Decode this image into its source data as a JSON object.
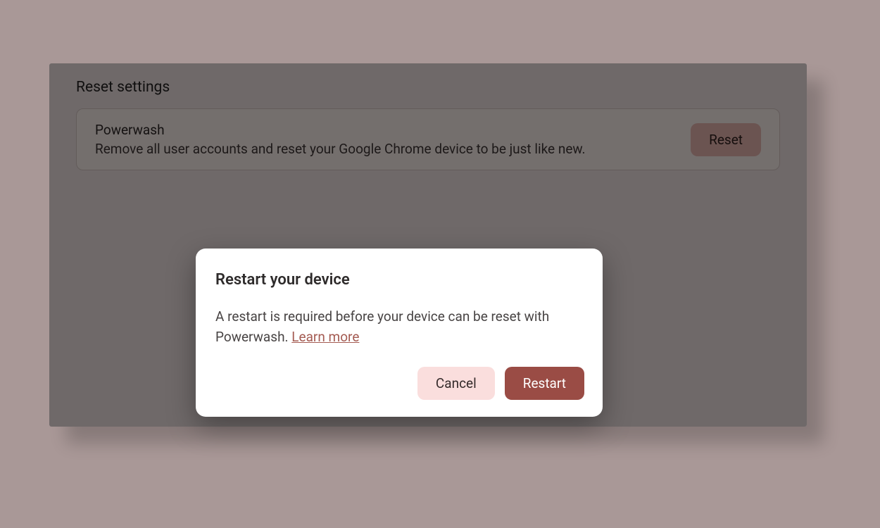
{
  "section": {
    "title": "Reset settings"
  },
  "row": {
    "title": "Powerwash",
    "description": "Remove all user accounts and reset your Google Chrome device to be just like new.",
    "reset_label": "Reset"
  },
  "dialog": {
    "title": "Restart your device",
    "body_pre": "A restart is required before your device can be reset with Powerwash. ",
    "learn_more": "Learn more",
    "cancel_label": "Cancel",
    "restart_label": "Restart"
  },
  "colors": {
    "page_bg": "#a99897",
    "panel_bg": "#dfd3d3",
    "row_bg": "#e8deda",
    "reset_btn_bg": "#d7a9a3",
    "link": "#a45b52",
    "cancel_bg": "#fadedd",
    "restart_bg": "#9a4c45"
  }
}
